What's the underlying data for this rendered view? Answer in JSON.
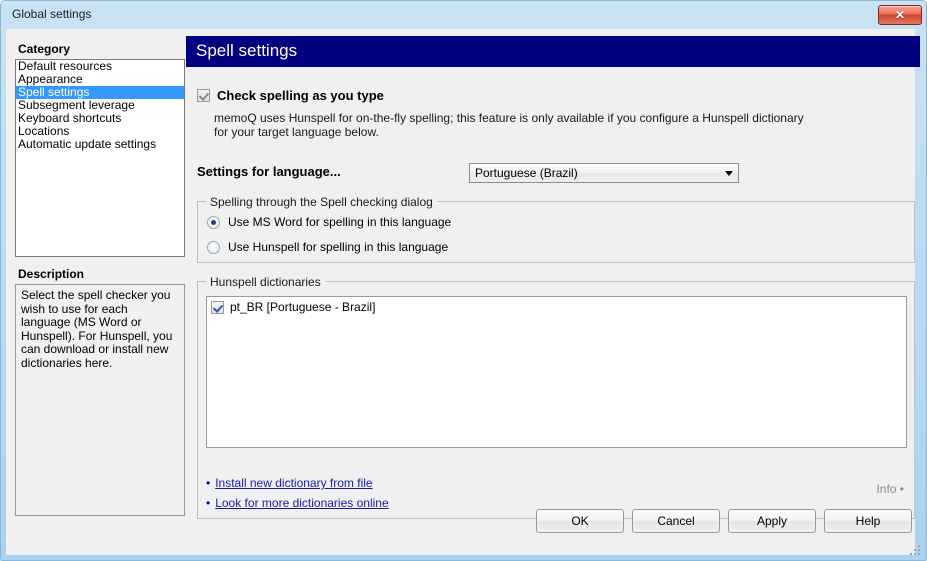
{
  "window": {
    "title": "Global settings",
    "close_label": "✕"
  },
  "sidebar": {
    "category_label": "Category",
    "items": [
      {
        "label": "Default resources",
        "selected": false
      },
      {
        "label": "Appearance",
        "selected": false
      },
      {
        "label": "Spell settings",
        "selected": true
      },
      {
        "label": "Subsegment leverage",
        "selected": false
      },
      {
        "label": "Keyboard shortcuts",
        "selected": false
      },
      {
        "label": "Locations",
        "selected": false
      },
      {
        "label": "Automatic update settings",
        "selected": false
      }
    ],
    "description_label": "Description",
    "description_text": "Select the spell checker you wish to use for each language (MS Word or Hunspell). For Hunspell, you can download or install new dictionaries here."
  },
  "main": {
    "header_title": "Spell settings",
    "check_spelling": {
      "label": "Check spelling as you type",
      "checked": true
    },
    "helper_text": "memoQ uses Hunspell for on-the-fly spelling; this feature is only available if you configure a Hunspell dictionary for your target language below.",
    "settings_for_language_label": "Settings for language...",
    "language_combo": {
      "value": "Portuguese (Brazil)",
      "options": [
        "Portuguese (Brazil)"
      ]
    },
    "spelling_group": {
      "legend": "Spelling through the Spell checking dialog",
      "options": [
        {
          "label": "Use MS Word for spelling in this language",
          "selected": true
        },
        {
          "label": "Use Hunspell for spelling in this language",
          "selected": false
        }
      ]
    },
    "dictionaries_group": {
      "legend": "Hunspell dictionaries",
      "items": [
        {
          "label": "pt_BR [Portuguese - Brazil]",
          "checked": true
        }
      ],
      "links": [
        "Install new dictionary from file",
        "Look for more dictionaries online"
      ],
      "info_label": "Info •"
    }
  },
  "buttons": {
    "ok": "OK",
    "cancel": "Cancel",
    "apply": "Apply",
    "help": "Help"
  },
  "colors": {
    "header_bar": "#000080",
    "selection": "#3399ff",
    "link": "#1a1aaa",
    "close_button": "#d4402c"
  }
}
